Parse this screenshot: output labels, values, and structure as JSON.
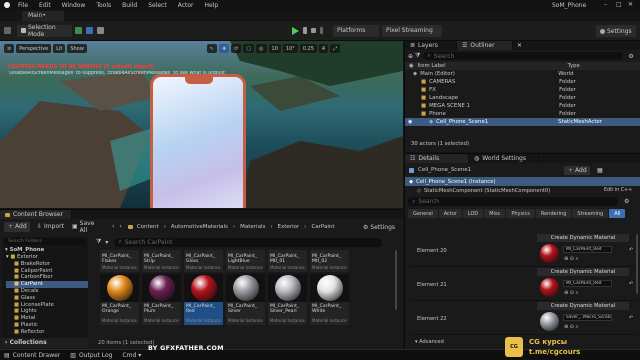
{
  "app": {
    "title": "SoM_Phone",
    "menu": [
      "File",
      "Edit",
      "Window",
      "Tools",
      "Build",
      "Select",
      "Actor",
      "Help"
    ],
    "level_tab": "Main•"
  },
  "toolbar": {
    "selection_mode": "Selection Mode",
    "platforms": "Platforms",
    "pixel_streaming": "Pixel Streaming",
    "settings": "Settings"
  },
  "viewport": {
    "perspective": "Perspective",
    "lit": "Lit",
    "show": "Show",
    "snap_angle": "10°",
    "snap_scale": "0.25",
    "cam_speed": "4",
    "grid": "10",
    "warning1": "LIGHTING NEEDS TO BE REBUILT (1 unbuilt object)",
    "warning2": "'DisableAllScreenMessages' to suppress, 'EnableAllScreenMessages' to see what is unbuilt"
  },
  "content_browser": {
    "tab": "Content Browser",
    "add": "Add",
    "import": "Import",
    "save_all": "Save All",
    "settings": "Settings",
    "search_placeholder": "Search CarPaint",
    "search_folders_placeholder": "Search Folders",
    "breadcrumb": [
      "Content",
      "AutomotiveMaterials",
      "Materials",
      "Exterior",
      "CarPaint"
    ],
    "root": "SoM_Phone",
    "folders": [
      "Exterior",
      "BrakeRotor",
      "CaliperPaint",
      "CarbonFiber",
      "CarPaint",
      "Decals",
      "Glass",
      "LicensePlate",
      "Lights",
      "Metal",
      "Plastic",
      "Reflector"
    ],
    "selected_folder": "CarPaint",
    "top_row": [
      {
        "name": "MI_CarPaint_\nFlakes",
        "type": "Material Instance"
      },
      {
        "name": "MI_CarPaint_\nStrip",
        "type": "Material Instance"
      },
      {
        "name": "MI_CarPaint_\nGloss",
        "type": "Material Instance"
      },
      {
        "name": "MI_CarPaint_\nLightBlue",
        "type": "Material Instance"
      },
      {
        "name": "MI_CarPaint_\nMtl_01",
        "type": "Material Instance"
      },
      {
        "name": "MI_CarPaint_\nMtl_02",
        "type": "Material Instance"
      }
    ],
    "assets": [
      {
        "name": "MI_CarPaint_\nOrange",
        "type": "Material Instance",
        "color": "#e38a1a"
      },
      {
        "name": "MI_CarPaint_\nPlum",
        "type": "Material Instance",
        "color": "#6c1f52"
      },
      {
        "name": "MI_CarPaint_\nRed",
        "type": "Material Instance",
        "color": "#b5121b"
      },
      {
        "name": "MI_CarPaint_\nSilver",
        "type": "Material Instance",
        "color": "#9a9da3"
      },
      {
        "name": "MI_CarPaint_\nSilver_Pearl",
        "type": "Material Instance",
        "color": "#b9bcc2"
      },
      {
        "name": "MI_CarPaint_\nWhite",
        "type": "Material Instance",
        "color": "#e4e4e4"
      }
    ],
    "item_count": "20 items (1 selected)",
    "collections": "Collections"
  },
  "outliner": {
    "tabs": [
      "Layers",
      "Outliner"
    ],
    "search_placeholder": "Search",
    "col_label": "Item Label",
    "col_type": "Type",
    "items": [
      {
        "label": "Main (Editor)",
        "type": "World",
        "indent": 0
      },
      {
        "label": "CAMERAS",
        "type": "Folder",
        "indent": 1
      },
      {
        "label": "FX",
        "type": "Folder",
        "indent": 1
      },
      {
        "label": "Landscape",
        "type": "Folder",
        "indent": 1
      },
      {
        "label": "MEGA SCENE 1",
        "type": "Folder",
        "indent": 1
      },
      {
        "label": "Phone",
        "type": "Folder",
        "indent": 1
      },
      {
        "label": "Cell_Phone_Scene1",
        "type": "StaticMeshActor",
        "indent": 2
      }
    ],
    "selected_index": 6,
    "count": "30 actors (1 selected)"
  },
  "details": {
    "tabs": [
      "Details",
      "World Settings"
    ],
    "actor_name": "Cell_Phone_Scene1",
    "add": "Add",
    "instance": "Cell_Phone_Scene1 (Instance)",
    "component": "StaticMeshComponent (StaticMeshComponent0)",
    "edit_cpp": "Edit in C++",
    "search_placeholder": "Search",
    "categories": [
      "General",
      "Actor",
      "LOD",
      "Misc",
      "Physics",
      "Rendering",
      "Streaming",
      "All"
    ],
    "elements": [
      {
        "label": "Element 20",
        "button": "Create Dynamic Material",
        "material": "MI_CarPaint_Red",
        "color": "#b3121a"
      },
      {
        "label": "Element 21",
        "button": "Create Dynamic Material",
        "material": "MI_CarPaint_Red",
        "color": "#b3121a"
      },
      {
        "label": "Element 22",
        "button": "Create Dynamic Material",
        "material": "Silver_..Macro_Scratches_3",
        "color": "#9aa0a6"
      }
    ],
    "advanced": "Advanced"
  },
  "status": {
    "drawer": "Content Drawer",
    "output": "Output Log",
    "cmd": "Cmd",
    "watermark": "BY GFXFATHER.COM",
    "promo1": "CG курсы",
    "promo2": "t.me/cgcours"
  }
}
